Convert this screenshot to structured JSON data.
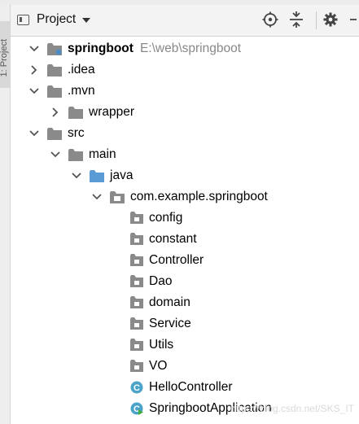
{
  "header": {
    "title": "Project",
    "icons": [
      "locate-icon",
      "collapse-all-icon",
      "settings-icon",
      "hide-panel-icon"
    ]
  },
  "sidebar": {
    "label": "1: Project"
  },
  "tree": {
    "root": {
      "label": "springboot",
      "path": "E:\\web\\springboot"
    },
    "idea": {
      "label": ".idea"
    },
    "mvn": {
      "label": ".mvn"
    },
    "wrapper": {
      "label": "wrapper"
    },
    "src": {
      "label": "src"
    },
    "main": {
      "label": "main"
    },
    "java": {
      "label": "java"
    },
    "package": {
      "label": "com.example.springboot"
    },
    "packages": [
      {
        "label": "config"
      },
      {
        "label": "constant"
      },
      {
        "label": "Controller"
      },
      {
        "label": "Dao"
      },
      {
        "label": "domain"
      },
      {
        "label": "Service"
      },
      {
        "label": "Utils"
      },
      {
        "label": "VO"
      }
    ],
    "classes": [
      {
        "label": "HelloController",
        "icon": "class-icon"
      },
      {
        "label": "SpringbootApplication",
        "icon": "spring-boot-class-icon"
      }
    ]
  },
  "colors": {
    "folder": "#8a8a8a",
    "source_folder": "#5b9bd5",
    "class_icon": "#4aa3c8",
    "header_bg": "#f3f3f3"
  },
  "watermark": "https://blog.csdn.net/SKS_IT"
}
